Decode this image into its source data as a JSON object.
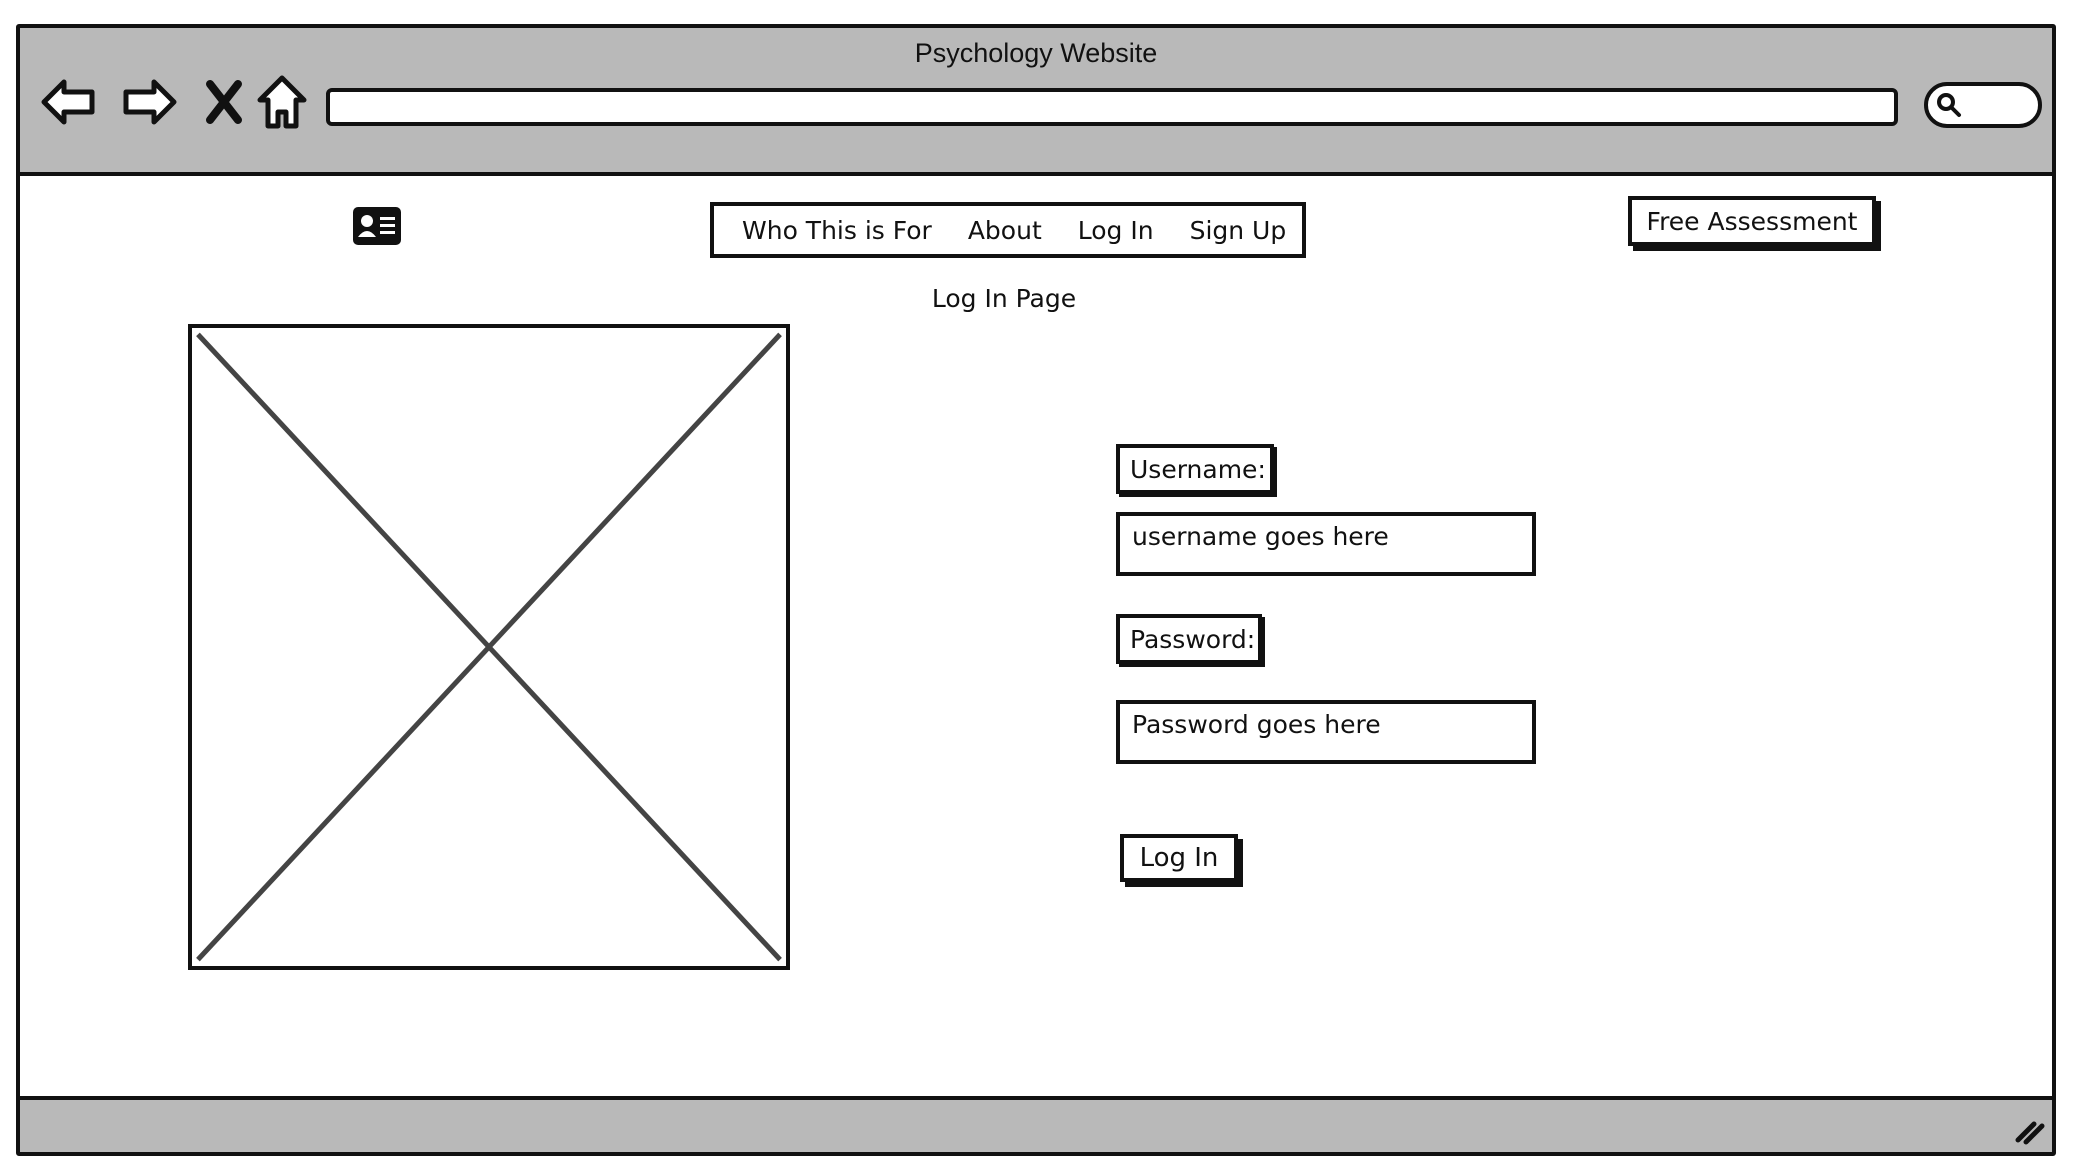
{
  "window": {
    "title": "Psychology Website"
  },
  "toolbar": {
    "icons": [
      "back-arrow-icon",
      "forward-arrow-icon",
      "close-x-icon",
      "home-icon",
      "search-icon"
    ],
    "url_value": ""
  },
  "header": {
    "logo_icon": "id-card-icon",
    "nav_items": [
      {
        "label": "Who This is For"
      },
      {
        "label": "About"
      },
      {
        "label": "Log In"
      },
      {
        "label": "Sign Up"
      }
    ],
    "cta_label": "Free Assessment"
  },
  "main": {
    "heading": "Log In Page",
    "image_placeholder_icon": "image-placeholder-x",
    "form": {
      "username_label": "Username:",
      "username_value": "username goes here",
      "password_label": "Password:",
      "password_value": "Password goes here",
      "submit_label": "Log In"
    }
  },
  "colors": {
    "chrome_gray": "#b9b9b9",
    "ink": "#111111",
    "background": "#ffffff"
  }
}
